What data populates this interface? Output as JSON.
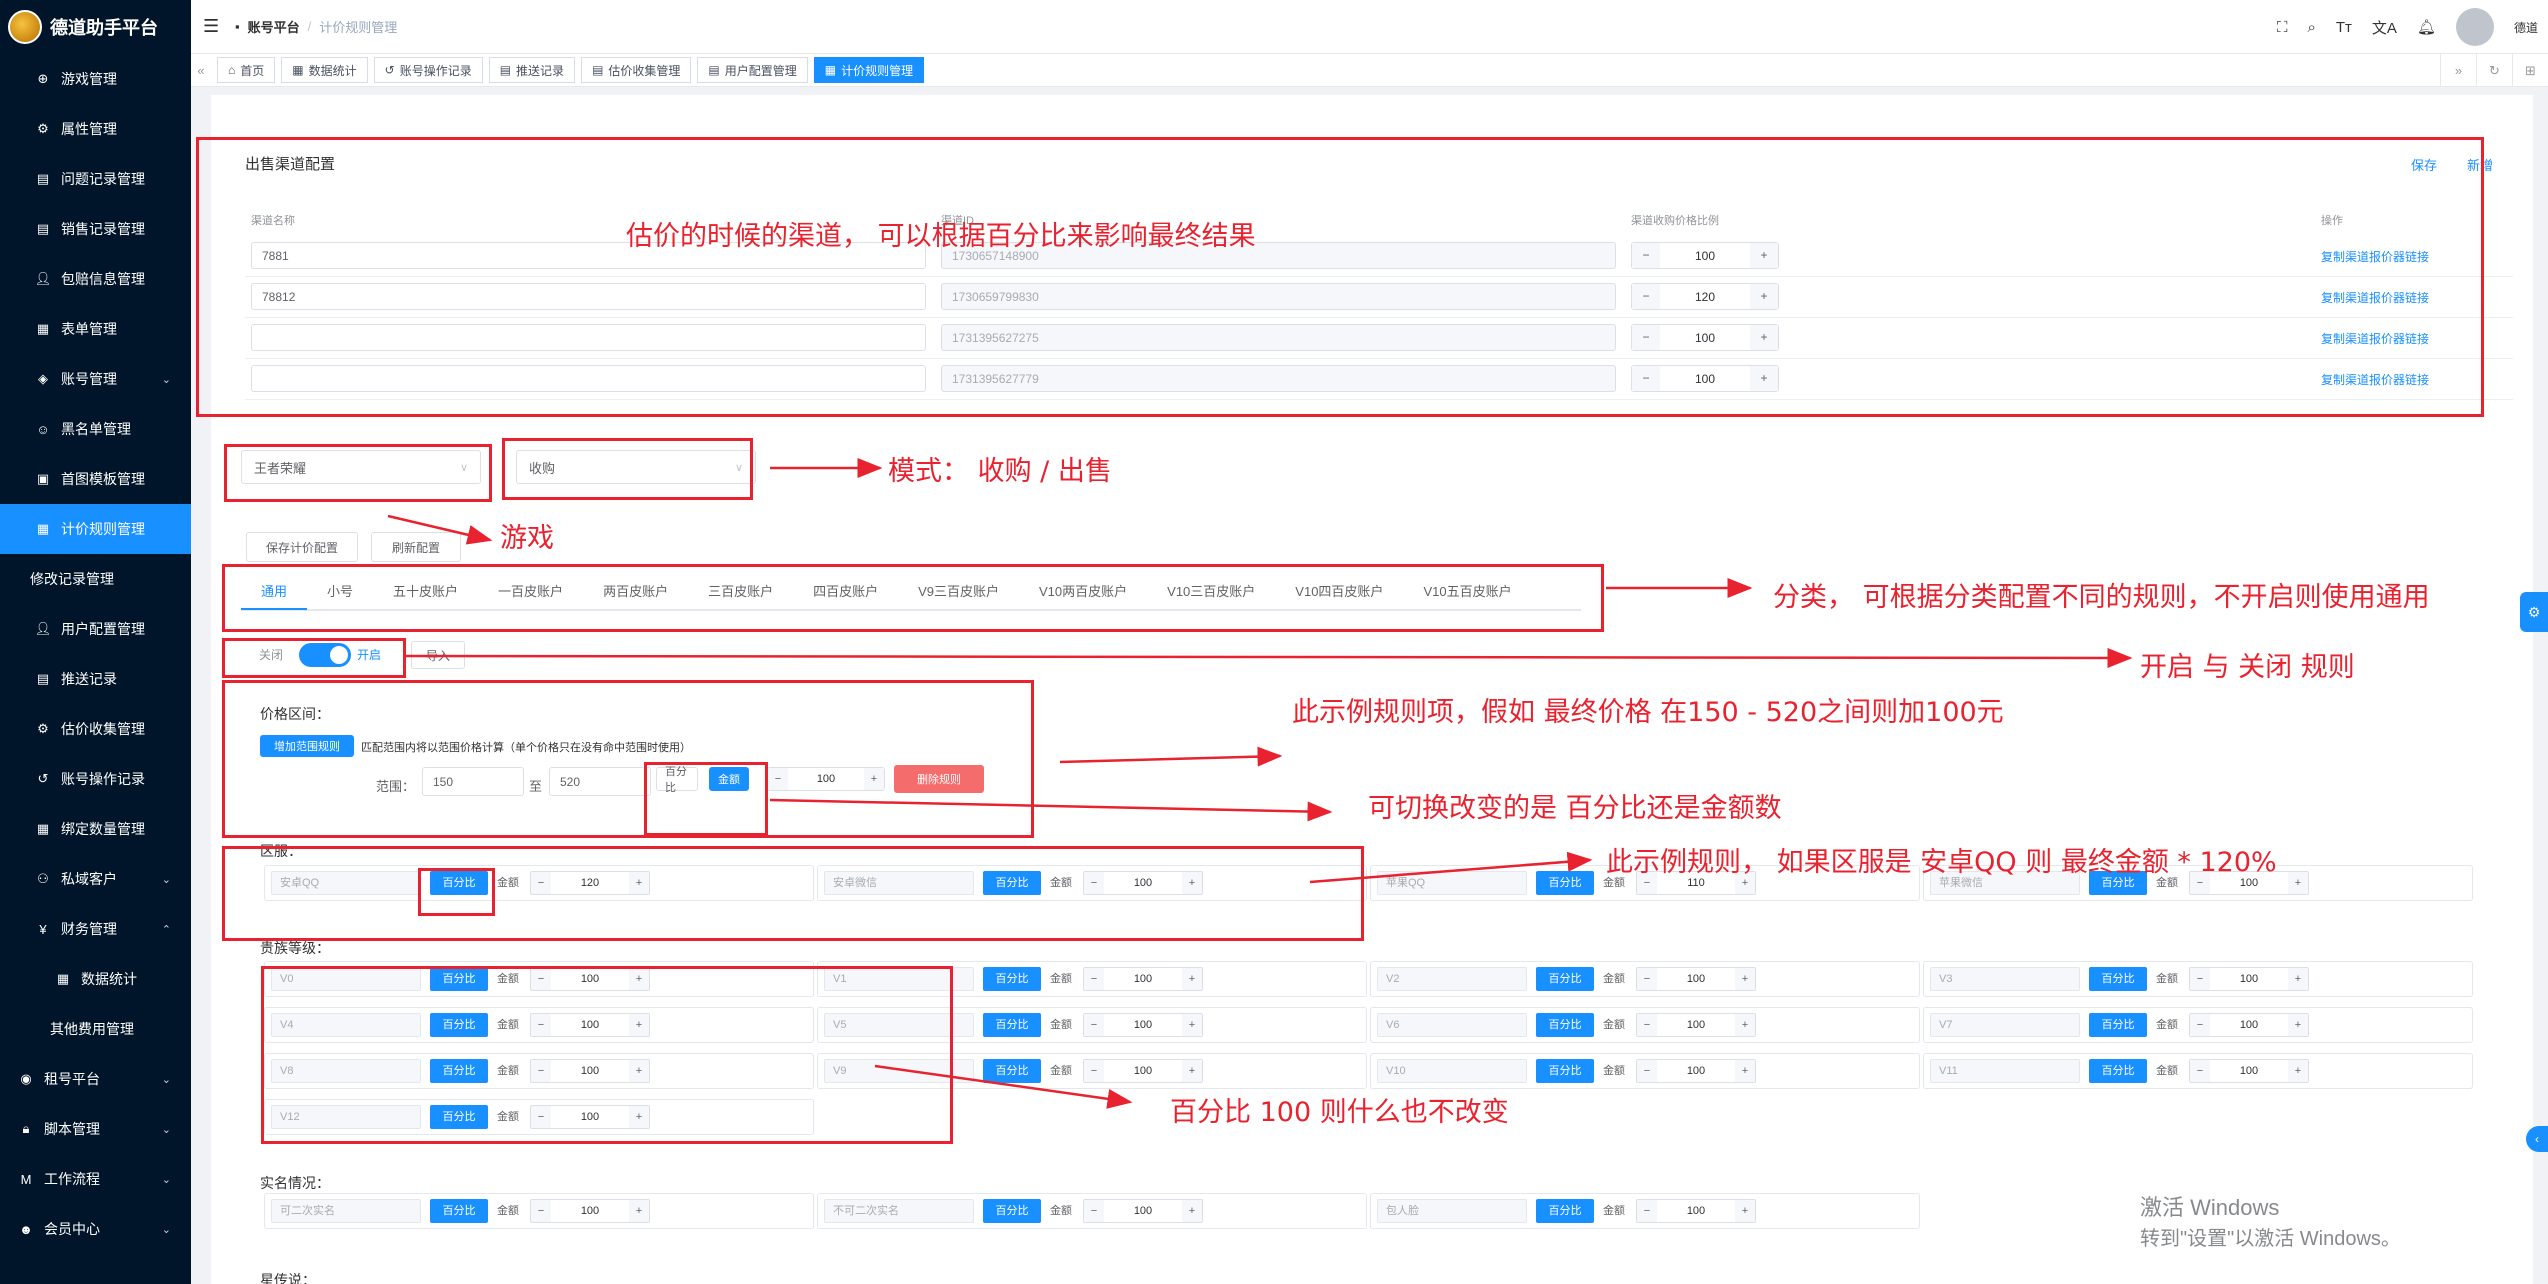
{
  "app": {
    "title": "德道助手平台"
  },
  "sidebar": {
    "items": [
      {
        "label": "游戏管理",
        "icon": "crosshair-icon",
        "chev": ""
      },
      {
        "label": "属性管理",
        "icon": "gear-icon",
        "chev": ""
      },
      {
        "label": "问题记录管理",
        "icon": "doc-icon",
        "chev": ""
      },
      {
        "label": "销售记录管理",
        "icon": "doc-icon",
        "chev": ""
      },
      {
        "label": "包赔信息管理",
        "icon": "user-icon",
        "chev": ""
      },
      {
        "label": "表单管理",
        "icon": "table-icon",
        "chev": ""
      },
      {
        "label": "账号管理",
        "icon": "layers-icon",
        "chev": "⌄"
      },
      {
        "label": "黑名单管理",
        "icon": "face-icon",
        "chev": ""
      },
      {
        "label": "首图模板管理",
        "icon": "image-icon",
        "chev": ""
      },
      {
        "label": "计价规则管理",
        "icon": "calc-icon",
        "chev": ""
      },
      {
        "label": "修改记录管理",
        "icon": "",
        "chev": ""
      },
      {
        "label": "用户配置管理",
        "icon": "user-icon",
        "chev": ""
      },
      {
        "label": "推送记录",
        "icon": "doc-icon",
        "chev": ""
      },
      {
        "label": "估价收集管理",
        "icon": "gear-icon",
        "chev": ""
      },
      {
        "label": "账号操作记录",
        "icon": "history-icon",
        "chev": ""
      },
      {
        "label": "绑定数量管理",
        "icon": "grid-icon",
        "chev": ""
      },
      {
        "label": "私域客户",
        "icon": "people-icon",
        "chev": "⌄"
      },
      {
        "label": "财务管理",
        "icon": "yen-icon",
        "chev": "⌃"
      },
      {
        "label": "数据统计",
        "icon": "calendar-icon",
        "chev": ""
      },
      {
        "label": "其他费用管理",
        "icon": "",
        "chev": ""
      },
      {
        "label": "租号平台",
        "icon": "eye-icon",
        "chev": "⌄"
      },
      {
        "label": "脚本管理",
        "icon": "lock-icon",
        "chev": "⌄"
      },
      {
        "label": "工作流程",
        "icon": "m-icon",
        "chev": "⌄"
      },
      {
        "label": "会员中心",
        "icon": "person-icon",
        "chev": "⌄"
      }
    ]
  },
  "header": {
    "breadcrumb": [
      "账号平台",
      "计价规则管理"
    ],
    "username": "德道"
  },
  "tabs": [
    {
      "label": "首页",
      "icon": "home-icon"
    },
    {
      "label": "数据统计",
      "icon": "grid-icon"
    },
    {
      "label": "账号操作记录",
      "icon": "history-icon"
    },
    {
      "label": "推送记录",
      "icon": "doc-icon"
    },
    {
      "label": "估价收集管理",
      "icon": "doc-icon"
    },
    {
      "label": "用户配置管理",
      "icon": "doc-icon"
    },
    {
      "label": "计价规则管理",
      "icon": "calc-icon"
    }
  ],
  "channel": {
    "title": "出售渠道配置",
    "actions": [
      "保存",
      "新增"
    ],
    "cols": [
      "渠道名称",
      "渠道ID",
      "渠道收购价格比例",
      "操作"
    ],
    "rows": [
      {
        "name": "7881",
        "id": "1730657148900",
        "ratio": "100",
        "link": "复制渠道报价器链接"
      },
      {
        "name": "78812",
        "id": "1730659799830",
        "ratio": "120",
        "link": "复制渠道报价器链接"
      },
      {
        "name": "",
        "id": "1731395627275",
        "ratio": "100",
        "link": "复制渠道报价器链接"
      },
      {
        "name": "",
        "id": "1731395627779",
        "ratio": "100",
        "link": "复制渠道报价器链接"
      }
    ]
  },
  "filters": {
    "game": "王者荣耀",
    "mode": "收购"
  },
  "buttons": {
    "save_config": "保存计价配置",
    "refresh_config": "刷新配置",
    "import": "导入",
    "add_range": "增加范围规则",
    "delete_rule": "删除规则"
  },
  "categories": [
    "通用",
    "小号",
    "五十皮账户",
    "一百皮账户",
    "两百皮账户",
    "三百皮账户",
    "四百皮账户",
    "V9三百皮账户",
    "V10两百皮账户",
    "V10三百皮账户",
    "V10四百皮账户",
    "V10五百皮账户"
  ],
  "toggle": {
    "off": "关闭",
    "on": "开启"
  },
  "price_range": {
    "label": "价格区间：",
    "hint": "匹配范围内将以范围价格计算（单个价格只在没有命中范围时使用）",
    "range_label": "范围：",
    "from": "150",
    "to_label": "至",
    "to": "520",
    "pct": "百分比",
    "amt": "金额",
    "value": "100"
  },
  "sections": {
    "region": {
      "label": "区服：",
      "items": [
        {
          "name": "安卓QQ",
          "value": "120"
        },
        {
          "name": "安卓微信",
          "value": "100"
        },
        {
          "name": "苹果QQ",
          "value": "110"
        },
        {
          "name": "苹果微信",
          "value": "100"
        }
      ]
    },
    "noble": {
      "label": "贵族等级：",
      "items": [
        {
          "name": "V0",
          "value": "100"
        },
        {
          "name": "V1",
          "value": "100"
        },
        {
          "name": "V2",
          "value": "100"
        },
        {
          "name": "V3",
          "value": "100"
        },
        {
          "name": "V4",
          "value": "100"
        },
        {
          "name": "V5",
          "value": "100"
        },
        {
          "name": "V6",
          "value": "100"
        },
        {
          "name": "V7",
          "value": "100"
        },
        {
          "name": "V8",
          "value": "100"
        },
        {
          "name": "V9",
          "value": "100"
        },
        {
          "name": "V10",
          "value": "100"
        },
        {
          "name": "V11",
          "value": "100"
        },
        {
          "name": "V12",
          "value": "100"
        }
      ]
    },
    "realname": {
      "label": "实名情况：",
      "items": [
        {
          "name": "可二次实名",
          "value": "100"
        },
        {
          "name": "不可二次实名",
          "value": "100"
        },
        {
          "name": "包人脸",
          "value": "100"
        }
      ]
    },
    "legend": {
      "label": "星传说："
    }
  },
  "common": {
    "pct": "百分比",
    "amt": "金额"
  },
  "annotations": {
    "channel": "估价的时候的渠道，  可以根据百分比来影响最终结果",
    "mode": "模式：  收购 /  出售",
    "game": "游戏",
    "category": "分类，  可根据分类配置不同的规则，不开启则使用通用",
    "toggle": "开启 与 关闭 规则",
    "range": "此示例规则项，假如 最终价格 在150 - 520之间则加100元",
    "switch": "可切换改变的是 百分比还是金额数",
    "region": "此示例规则，  如果区服是 安卓QQ 则 最终金额 * 120%",
    "noble": "百分比  100 则什么也不改变"
  },
  "watermark": {
    "line1": "激活 Windows",
    "line2": "转到\"设置\"以激活 Windows。"
  }
}
